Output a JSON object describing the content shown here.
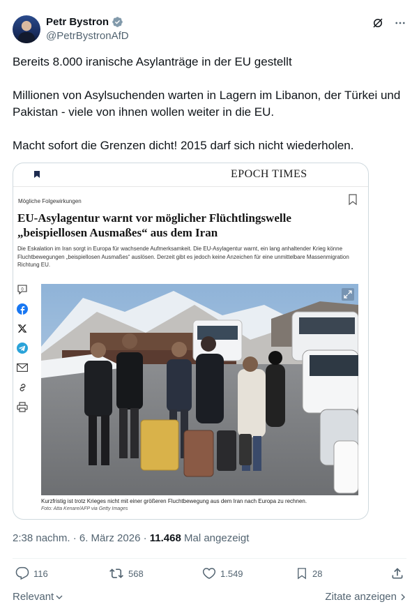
{
  "author": {
    "name": "Petr Bystron",
    "handle": "@PetrBystronAfD"
  },
  "tweet": {
    "paragraphs": [
      "Bereits 8.000 iranische Asylanträge in der EU gestellt",
      "Millionen von Asylsuchenden warten in Lagern im Libanon, der Türkei und Pakistan  - viele von ihnen wollen weiter in die EU.",
      "Macht sofort die Grenzen dicht! 2015 darf sich nicht wiederholen."
    ]
  },
  "article": {
    "masthead": "EPOCH TIMES",
    "kicker": "Mögliche Folgewirkungen",
    "headline": "EU-Asylagentur warnt vor möglicher Flüchtlingswelle „beispiellosen Ausmaßes“ aus dem Iran",
    "lead": "Die Eskalation im Iran sorgt in Europa für wachsende Aufmerksamkeit. Die EU-Asylagentur warnt, ein lang anhaltender Krieg könne Fluchtbewegungen „beispiellosen Ausmaßes“ auslösen. Derzeit gibt es jedoch keine Anzeichen für eine unmittelbare Massenmigration Richtung EU.",
    "caption": "Kurzfristig ist trotz Krieges nicht mit einer größeren Fluchtbewegung aus dem Iran nach Europa zu rechnen.",
    "credit": "Foto: Atta Kenare/AFP via Getty Images",
    "comment_count": "0",
    "share_icons": [
      "comment-icon",
      "facebook-icon",
      "x-icon",
      "telegram-icon",
      "mail-icon",
      "link-icon",
      "print-icon"
    ]
  },
  "meta": {
    "time": "2:38 nachm. · 6. März 2026 · ",
    "views": "11.468",
    "views_label": " Mal angezeigt"
  },
  "actions": {
    "replies": "116",
    "reposts": "568",
    "likes": "1.549",
    "bookmarks": "28"
  },
  "footer": {
    "relevant": "Relevant",
    "quotes": "Zitate anzeigen"
  },
  "colors": {
    "secondary_text": "#536471",
    "verified": "#829aab",
    "facebook": "#1877f2",
    "telegram": "#2aa3d9"
  }
}
